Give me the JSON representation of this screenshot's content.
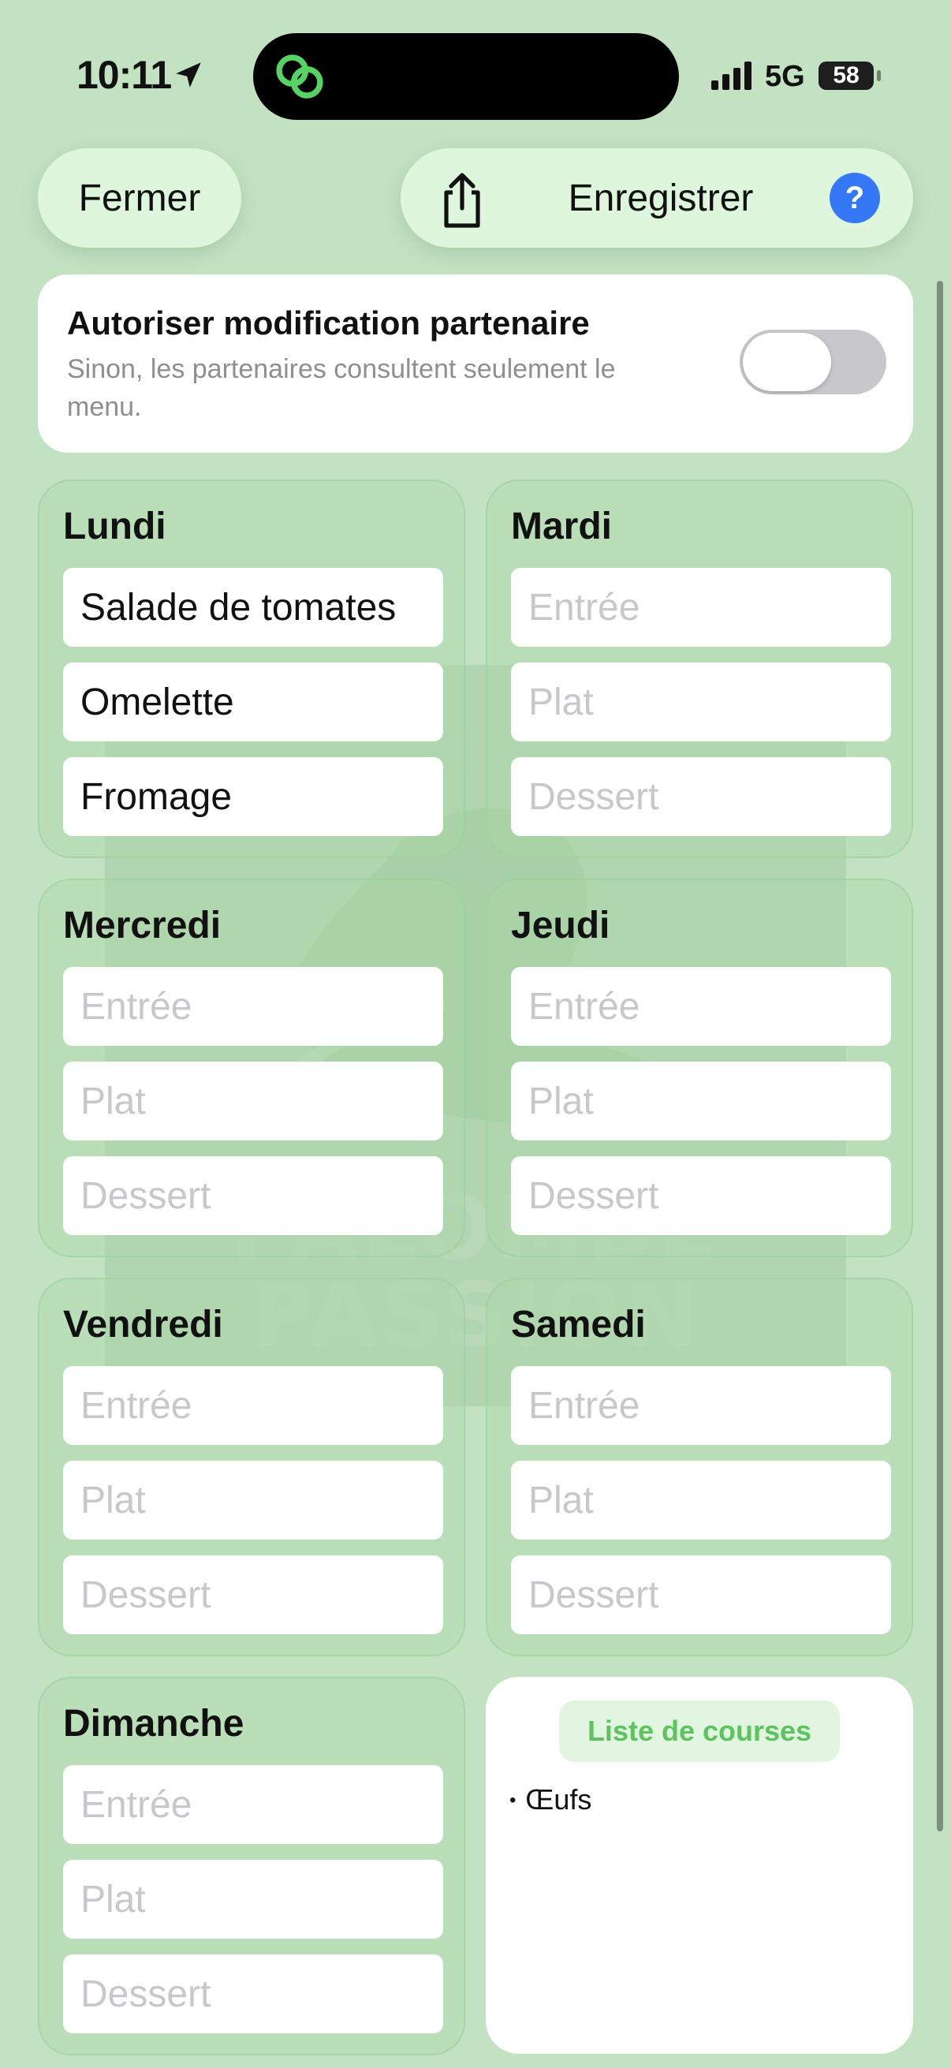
{
  "status": {
    "time": "10:11",
    "network": "5G",
    "battery": "58",
    "battery_level": 0.58
  },
  "toolbar": {
    "close_label": "Fermer",
    "save_label": "Enregistrer",
    "help_label": "?"
  },
  "partner": {
    "title": "Autoriser modification partenaire",
    "description": "Sinon, les partenaires consultent seulement le menu.",
    "toggle_on": false
  },
  "days": [
    {
      "name": "Lundi",
      "starter": "Salade de tomates",
      "main": "Omelette",
      "dessert": "Fromage"
    },
    {
      "name": "Mardi",
      "starter": "",
      "main": "",
      "dessert": ""
    },
    {
      "name": "Mercredi",
      "starter": "",
      "main": "",
      "dessert": ""
    },
    {
      "name": "Jeudi",
      "starter": "",
      "main": "",
      "dessert": ""
    },
    {
      "name": "Vendredi",
      "starter": "",
      "main": "",
      "dessert": ""
    },
    {
      "name": "Samedi",
      "starter": "",
      "main": "",
      "dessert": ""
    },
    {
      "name": "Dimanche",
      "starter": "",
      "main": "",
      "dessert": ""
    }
  ],
  "placeholders": {
    "starter": "Entrée",
    "main": "Plat",
    "dessert": "Dessert"
  },
  "shopping": {
    "title": "Liste de courses",
    "items": [
      "Œufs"
    ]
  },
  "watermark": {
    "line1": "PALOMBE",
    "line2": "PASSION"
  },
  "icons": {
    "location": "location-arrow-icon",
    "island_app": "linked-rings-icon",
    "signal": "cellular-signal-icon",
    "share": "share-icon",
    "help": "question-mark-icon"
  },
  "colors": {
    "background": "#c3e2c2",
    "accent_green": "#5cc45c",
    "help_blue": "#3478f6",
    "pill": "#ddf6dc"
  }
}
